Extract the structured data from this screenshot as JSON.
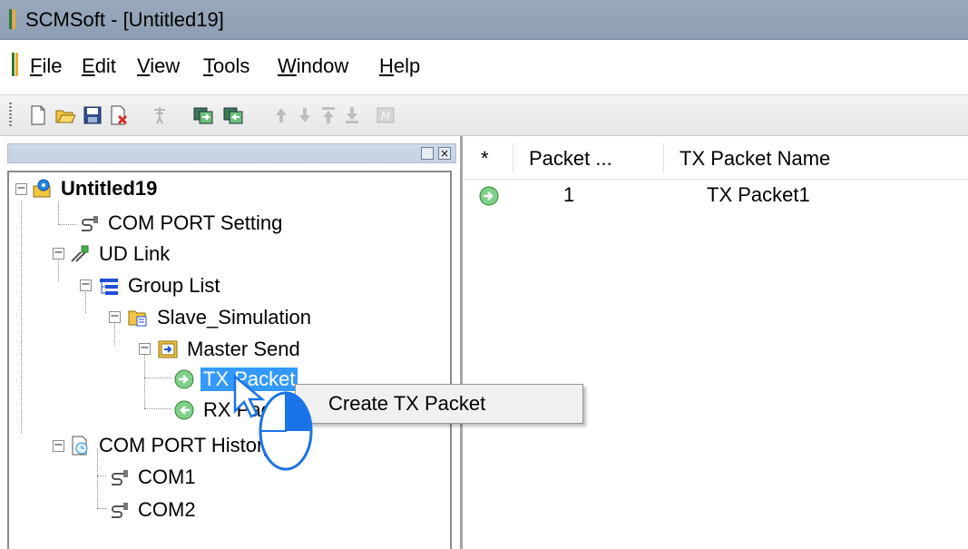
{
  "window": {
    "title": "SCMSoft - [Untitled19]"
  },
  "menu": {
    "items": [
      {
        "label": "File",
        "accel": "F",
        "rest": "ile"
      },
      {
        "label": "Edit",
        "accel": "E",
        "rest": "dit"
      },
      {
        "label": "View",
        "accel": "V",
        "rest": "iew"
      },
      {
        "label": "Tools",
        "accel": "T",
        "rest": "ools"
      },
      {
        "label": "Window",
        "accel": "W",
        "rest": "indow"
      },
      {
        "label": "Help",
        "accel": "H",
        "rest": "elp"
      }
    ]
  },
  "toolbar": {
    "buttons": [
      "new-icon",
      "open-icon",
      "save-icon",
      "delete-file-icon",
      "pin-icon",
      "send-packet-icon",
      "receive-packet-icon",
      "move-up-icon",
      "move-down-icon",
      "move-top-icon",
      "move-bottom-icon",
      "monitor-icon"
    ],
    "monitor_label": "M"
  },
  "left_pane": {
    "close_glyph": "×"
  },
  "tree": {
    "root": "Untitled19",
    "com_port_setting": "COM PORT Setting",
    "ud_link": "UD Link",
    "group_list": "Group List",
    "slave_simulation": "Slave_Simulation",
    "master_send": "Master Send",
    "tx_packet": "TX Packet",
    "rx_packet": "RX Packet",
    "com_port_history": "COM PORT History",
    "com1": "COM1",
    "com2": "COM2",
    "expanders": {
      "collapse": "−"
    }
  },
  "packet_list": {
    "columns": {
      "star": "*",
      "packet": "Packet ...",
      "name": "TX Packet Name"
    },
    "rows": [
      {
        "number": "1",
        "name": "TX Packet1"
      }
    ]
  },
  "context_menu": {
    "item": "Create TX Packet"
  },
  "colors": {
    "title_bar": "#9aa9bd",
    "selection": "#3399ff",
    "cursor_accent": "#1a73e8",
    "packet_icon": "#4caf50"
  }
}
